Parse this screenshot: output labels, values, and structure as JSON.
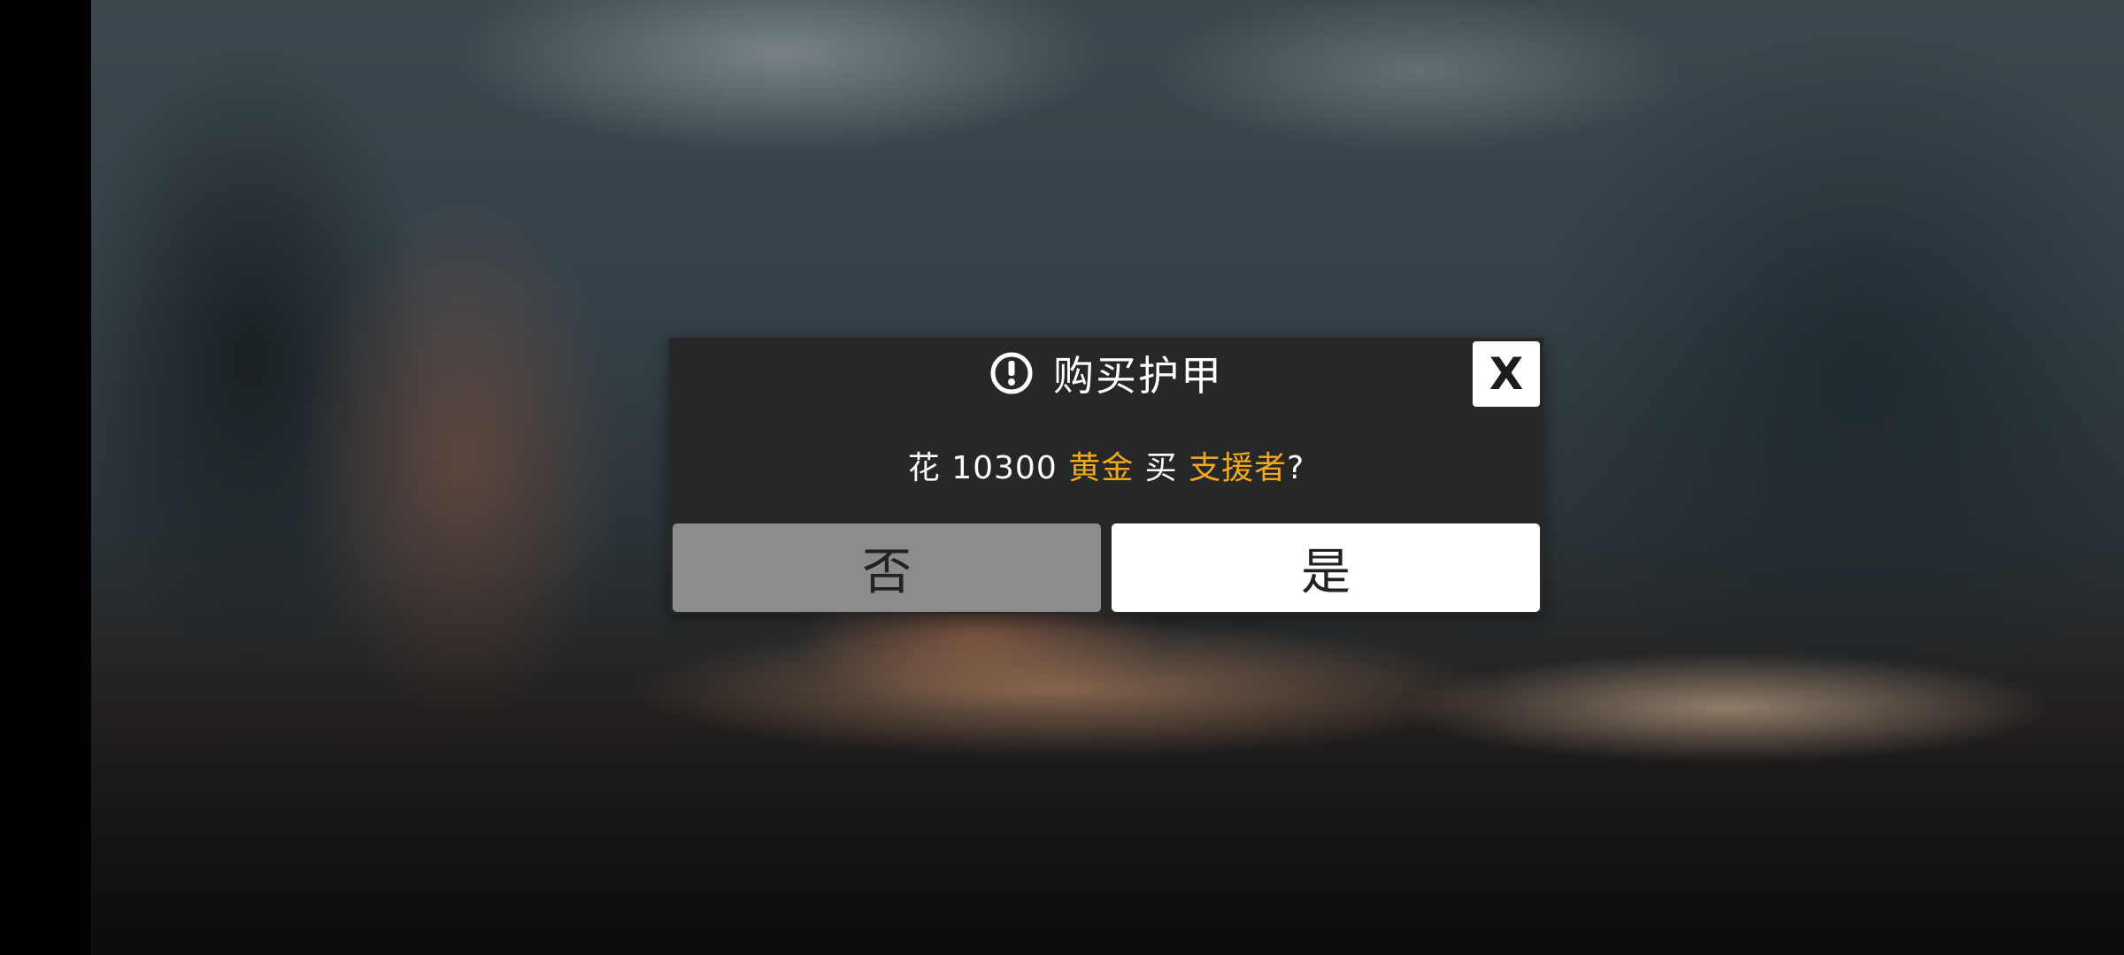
{
  "dialog": {
    "icon": "exclamation-circle-icon",
    "title": "购买护甲",
    "close_label": "X",
    "message": {
      "prefix": "花 10300 ",
      "currency": "黄金",
      "middle": " 买 ",
      "item": "支援者",
      "suffix": "?"
    },
    "buttons": {
      "no_label": "否",
      "yes_label": "是"
    },
    "colors": {
      "panel": "#252728",
      "highlight": "#f2a81d",
      "no_button": "#8c8c8c",
      "yes_button": "#ffffff"
    }
  }
}
